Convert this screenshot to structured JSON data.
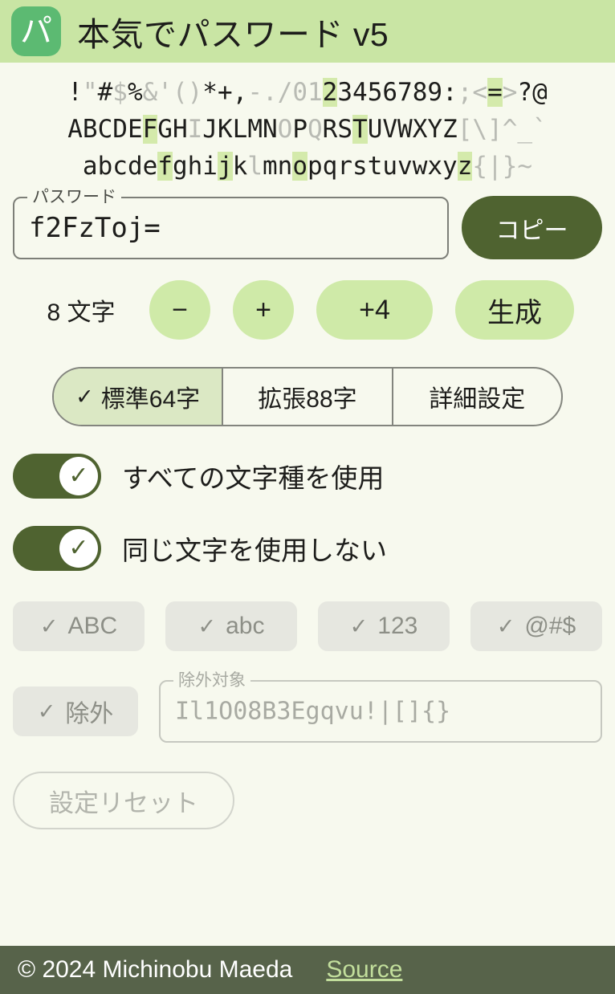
{
  "header": {
    "logo_glyph": "パ",
    "title": "本気でパスワード v5"
  },
  "charmap": {
    "rows": [
      [
        {
          "t": "!",
          "s": "on"
        },
        {
          "t": "\"",
          "s": "off"
        },
        {
          "t": "#",
          "s": "on"
        },
        {
          "t": "$",
          "s": "off"
        },
        {
          "t": "%",
          "s": "on"
        },
        {
          "t": "&",
          "s": "off"
        },
        {
          "t": "'",
          "s": "off"
        },
        {
          "t": "(",
          "s": "off"
        },
        {
          "t": ")",
          "s": "off"
        },
        {
          "t": "*",
          "s": "on"
        },
        {
          "t": "+",
          "s": "on"
        },
        {
          "t": ",",
          "s": "on"
        },
        {
          "t": "-",
          "s": "off"
        },
        {
          "t": ".",
          "s": "off"
        },
        {
          "t": "/",
          "s": "off"
        },
        {
          "t": "0",
          "s": "off"
        },
        {
          "t": "1",
          "s": "off"
        },
        {
          "t": "2",
          "s": "hit"
        },
        {
          "t": "3",
          "s": "on"
        },
        {
          "t": "4",
          "s": "on"
        },
        {
          "t": "5",
          "s": "on"
        },
        {
          "t": "6",
          "s": "on"
        },
        {
          "t": "7",
          "s": "on"
        },
        {
          "t": "8",
          "s": "on"
        },
        {
          "t": "9",
          "s": "on"
        },
        {
          "t": ":",
          "s": "on"
        },
        {
          "t": ";",
          "s": "off"
        },
        {
          "t": "<",
          "s": "off"
        },
        {
          "t": "=",
          "s": "hit"
        },
        {
          "t": ">",
          "s": "off"
        },
        {
          "t": "?",
          "s": "on"
        },
        {
          "t": "@",
          "s": "on"
        }
      ],
      [
        {
          "t": "A",
          "s": "on"
        },
        {
          "t": "B",
          "s": "on"
        },
        {
          "t": "C",
          "s": "on"
        },
        {
          "t": "D",
          "s": "on"
        },
        {
          "t": "E",
          "s": "on"
        },
        {
          "t": "F",
          "s": "hit"
        },
        {
          "t": "G",
          "s": "on"
        },
        {
          "t": "H",
          "s": "on"
        },
        {
          "t": "I",
          "s": "off"
        },
        {
          "t": "J",
          "s": "on"
        },
        {
          "t": "K",
          "s": "on"
        },
        {
          "t": "L",
          "s": "on"
        },
        {
          "t": "M",
          "s": "on"
        },
        {
          "t": "N",
          "s": "on"
        },
        {
          "t": "O",
          "s": "off"
        },
        {
          "t": "P",
          "s": "on"
        },
        {
          "t": "Q",
          "s": "off"
        },
        {
          "t": "R",
          "s": "on"
        },
        {
          "t": "S",
          "s": "on"
        },
        {
          "t": "T",
          "s": "hit"
        },
        {
          "t": "U",
          "s": "on"
        },
        {
          "t": "V",
          "s": "on"
        },
        {
          "t": "W",
          "s": "on"
        },
        {
          "t": "X",
          "s": "on"
        },
        {
          "t": "Y",
          "s": "on"
        },
        {
          "t": "Z",
          "s": "on"
        },
        {
          "t": "[",
          "s": "off"
        },
        {
          "t": "\\",
          "s": "off"
        },
        {
          "t": "]",
          "s": "off"
        },
        {
          "t": "^",
          "s": "off"
        },
        {
          "t": "_",
          "s": "off"
        },
        {
          "t": "`",
          "s": "off"
        }
      ],
      [
        {
          "t": "a",
          "s": "on"
        },
        {
          "t": "b",
          "s": "on"
        },
        {
          "t": "c",
          "s": "on"
        },
        {
          "t": "d",
          "s": "on"
        },
        {
          "t": "e",
          "s": "on"
        },
        {
          "t": "f",
          "s": "hit"
        },
        {
          "t": "g",
          "s": "on"
        },
        {
          "t": "h",
          "s": "on"
        },
        {
          "t": "i",
          "s": "on"
        },
        {
          "t": "j",
          "s": "hit"
        },
        {
          "t": "k",
          "s": "on"
        },
        {
          "t": "l",
          "s": "off"
        },
        {
          "t": "m",
          "s": "on"
        },
        {
          "t": "n",
          "s": "on"
        },
        {
          "t": "o",
          "s": "hit"
        },
        {
          "t": "p",
          "s": "on"
        },
        {
          "t": "q",
          "s": "on"
        },
        {
          "t": "r",
          "s": "on"
        },
        {
          "t": "s",
          "s": "on"
        },
        {
          "t": "t",
          "s": "on"
        },
        {
          "t": "u",
          "s": "on"
        },
        {
          "t": "v",
          "s": "on"
        },
        {
          "t": "w",
          "s": "on"
        },
        {
          "t": "x",
          "s": "on"
        },
        {
          "t": "y",
          "s": "on"
        },
        {
          "t": "z",
          "s": "hit"
        },
        {
          "t": "{",
          "s": "off"
        },
        {
          "t": "|",
          "s": "off"
        },
        {
          "t": "}",
          "s": "off"
        },
        {
          "t": "~",
          "s": "off"
        }
      ]
    ]
  },
  "password": {
    "legend": "パスワード",
    "value": "f2FzToj=",
    "copy_label": "コピー"
  },
  "length": {
    "label": "8 文字",
    "minus_label": "−",
    "plus_label": "+",
    "plus4_label": "+4",
    "generate_label": "生成"
  },
  "segments": [
    {
      "label": "標準64字",
      "check": "✓",
      "active": true
    },
    {
      "label": "拡張88字",
      "check": "",
      "active": false
    },
    {
      "label": "詳細設定",
      "check": "",
      "active": false
    }
  ],
  "toggles": [
    {
      "label": "すべての文字種を使用",
      "check": "✓",
      "on": true
    },
    {
      "label": "同じ文字を使用しない",
      "check": "✓",
      "on": true
    }
  ],
  "charset_chips": [
    {
      "check": "✓",
      "label": "ABC"
    },
    {
      "check": "✓",
      "label": "abc"
    },
    {
      "check": "✓",
      "label": "123"
    },
    {
      "check": "✓",
      "label": "@#$"
    }
  ],
  "exclude": {
    "chip_check": "✓",
    "chip_label": "除外",
    "field_legend": "除外対象",
    "field_value": "Il1O08B3Egqvu!|[]{}"
  },
  "reset": {
    "label": "設定リセット"
  },
  "footer": {
    "copyright": "© 2024 Michinobu Maeda",
    "source_label": "Source"
  },
  "colors": {
    "header_bg": "#c9e5a4",
    "logo_bg": "#5cba72",
    "page_bg": "#f7f9ee",
    "accent_dark": "#4f6330",
    "accent_light": "#cfeaa8",
    "highlight": "#d4eaab",
    "muted_text": "#b9bbb4",
    "footer_bg": "#57634a",
    "link": "#c2de9c"
  }
}
